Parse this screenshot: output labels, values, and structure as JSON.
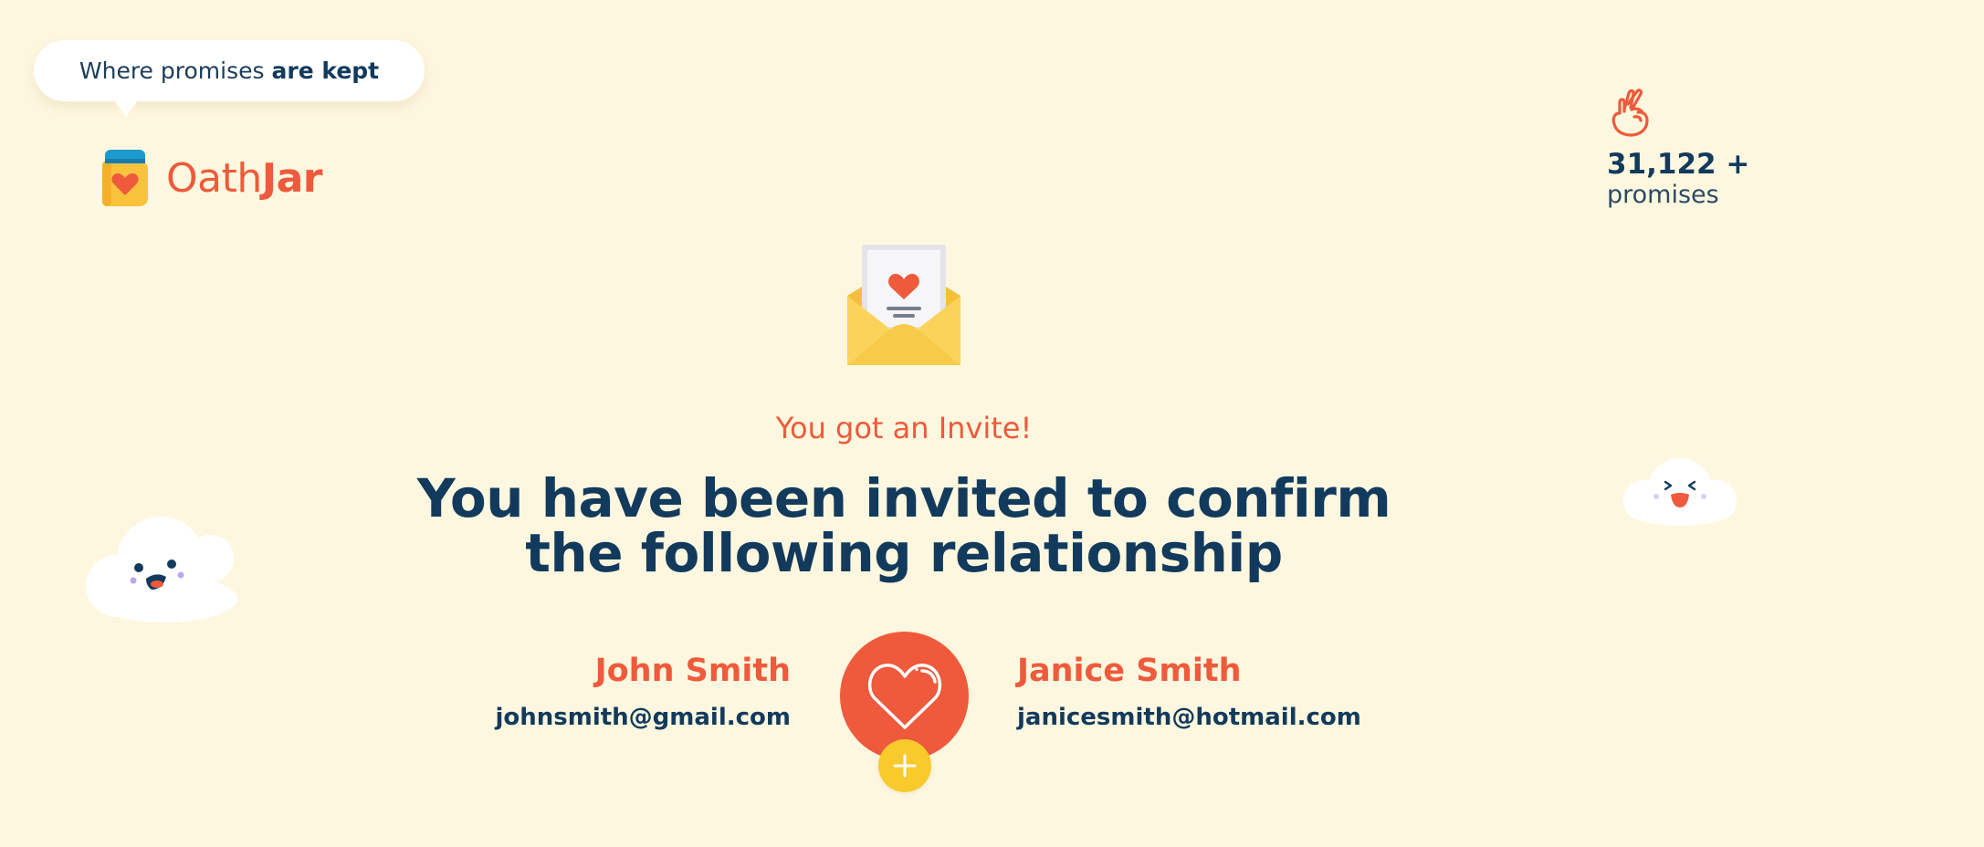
{
  "tagline": {
    "prefix": "Where promises",
    "emphasis": "are kept"
  },
  "logo": {
    "light": "Oath",
    "bold": "Jar",
    "icon": "jar-heart-icon"
  },
  "counter": {
    "icon": "crossed-fingers-icon",
    "value": "31,122 +",
    "label": "promises"
  },
  "invite": {
    "icon": "envelope-letter-icon",
    "subtitle": "You got an Invite!",
    "title_line1": "You have been invited to confirm",
    "title_line2": "the following relationship"
  },
  "partners": {
    "left": {
      "name": "John Smith",
      "email": "johnsmith@gmail.com"
    },
    "right": {
      "name": "Janice Smith",
      "email": "janicesmith@hotmail.com"
    },
    "center_icon": "heart-icon",
    "add_icon": "plus-icon"
  },
  "colors": {
    "background": "#fef7df",
    "accent": "#ee5a3b",
    "navy": "#123a5c",
    "yellow": "#f8ca2c",
    "jar_lid": "#1d9bd1"
  }
}
